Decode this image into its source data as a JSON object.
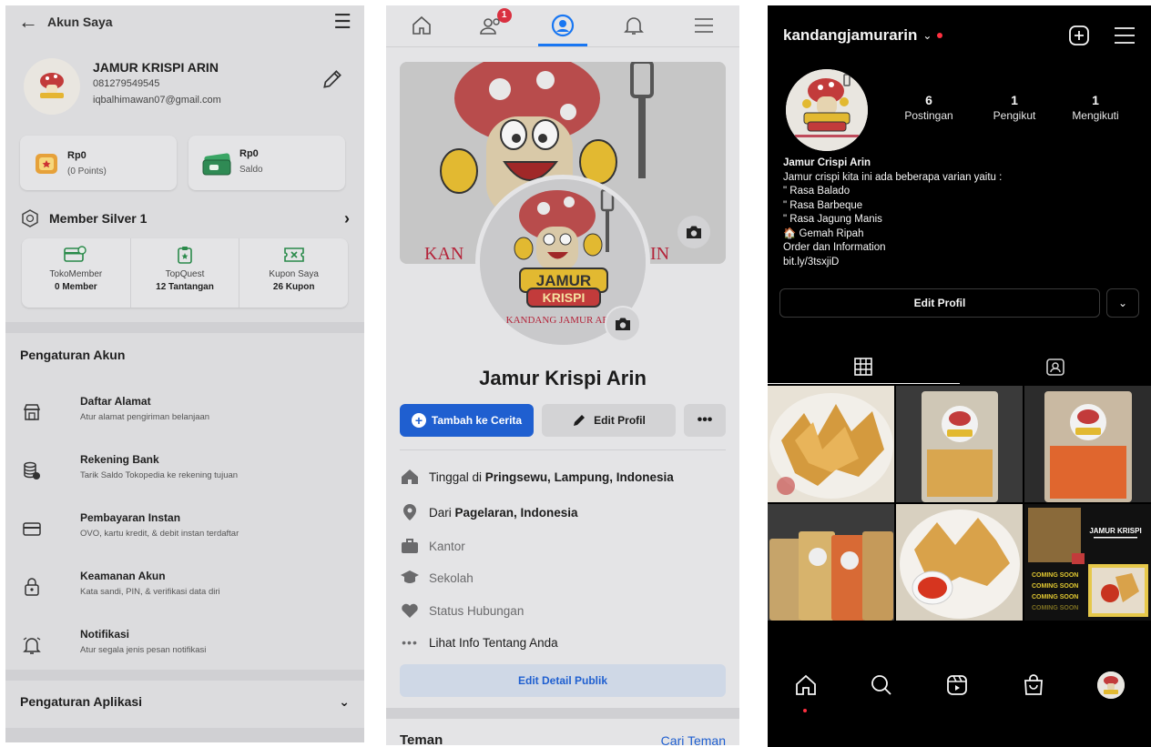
{
  "tokopedia": {
    "header_title": "Akun Saya",
    "profile": {
      "name": "JAMUR KRISPI ARIN",
      "phone": "081279549545",
      "email": "iqbalhimawan07@gmail.com"
    },
    "wallets": [
      {
        "amount": "Rp0",
        "sub": "(0 Points)"
      },
      {
        "amount": "Rp0",
        "sub": "Saldo"
      }
    ],
    "member_title": "Member Silver 1",
    "member_items": [
      {
        "label": "TokoMember",
        "value": "0 Member"
      },
      {
        "label": "TopQuest",
        "value": "12 Tantangan"
      },
      {
        "label": "Kupon Saya",
        "value": "26 Kupon"
      }
    ],
    "account_settings_title": "Pengaturan Akun",
    "settings": [
      {
        "title": "Daftar Alamat",
        "subtitle": "Atur alamat pengiriman belanjaan",
        "icon": "store-icon"
      },
      {
        "title": "Rekening Bank",
        "subtitle": "Tarik Saldo Tokopedia ke rekening tujuan",
        "icon": "bank-icon"
      },
      {
        "title": "Pembayaran Instan",
        "subtitle": "OVO, kartu kredit, & debit instan terdaftar",
        "icon": "card-icon"
      },
      {
        "title": "Keamanan Akun",
        "subtitle": "Kata sandi, PIN, & verifikasi data diri",
        "icon": "lock-icon"
      },
      {
        "title": "Notifikasi",
        "subtitle": "Atur segala jenis pesan notifikasi",
        "icon": "bell-icon"
      }
    ],
    "app_settings_title": "Pengaturan Aplikasi"
  },
  "facebook": {
    "notification_count": "1",
    "cover_text_left": "KAN",
    "cover_text_right": "IN",
    "profile_name": "Jamur Krispi Arin",
    "buttons": {
      "add_story": "Tambah ke Cerita",
      "edit_profile": "Edit Profil",
      "more": "•••"
    },
    "info": [
      {
        "prefix": "Tinggal di ",
        "bold": "Pringsewu, Lampung, Indonesia",
        "icon": "home-icon"
      },
      {
        "prefix": "Dari ",
        "bold": "Pagelaran, Indonesia",
        "icon": "location-pin-icon"
      },
      {
        "prefix": "Kantor",
        "bold": "",
        "icon": "briefcase-icon"
      },
      {
        "prefix": "Sekolah",
        "bold": "",
        "icon": "graduation-cap-icon"
      },
      {
        "prefix": "Status Hubungan",
        "bold": "",
        "icon": "heart-icon"
      },
      {
        "prefix": "Lihat Info Tentang Anda",
        "bold": "",
        "icon": "more-dots-icon"
      }
    ],
    "edit_public_details": "Edit Detail Publik",
    "friends_title": "Teman",
    "find_friends": "Cari Teman"
  },
  "instagram": {
    "username": "kandangjamurarin",
    "stats": [
      {
        "number": "6",
        "label": "Postingan"
      },
      {
        "number": "1",
        "label": "Pengikut"
      },
      {
        "number": "1",
        "label": "Mengikuti"
      }
    ],
    "bio_name": "Jamur Crispi Arin",
    "bio_lines": [
      "Jamur crispi kita ini ada beberapa varian yaitu :",
      "\" Rasa Balado",
      "\" Rasa Barbeque",
      "\" Rasa Jagung Manis",
      "🏠 Gemah Ripah",
      "Order dan Information",
      "bit.ly/3tsxjiD"
    ],
    "edit_profile": "Edit Profil",
    "post_text": {
      "brand": "JAMUR KRISPI",
      "coming_soon": "COMING SOON"
    }
  },
  "logo_text": {
    "line1": "JAMUR",
    "line2": "KRISPI",
    "caption": "KANDANG JAMUR ARIN"
  },
  "colors": {
    "fb_blue": "#1f5fd0",
    "ig_red": "#ff3040",
    "logo_red": "#b4243a"
  }
}
